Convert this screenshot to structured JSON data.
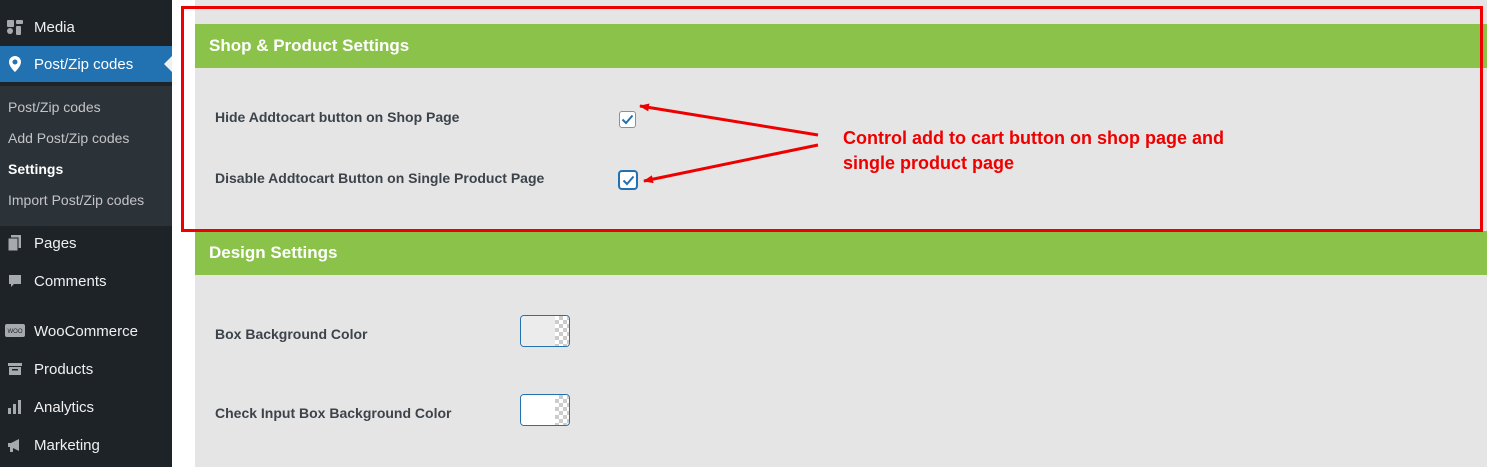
{
  "sidebar": {
    "items": [
      {
        "label": "Media",
        "icon": "media-icon"
      },
      {
        "label": "Post/Zip codes",
        "icon": "location-pin-icon",
        "active": true
      },
      {
        "label": "Pages",
        "icon": "pages-icon"
      },
      {
        "label": "Comments",
        "icon": "comments-icon"
      },
      {
        "label": "WooCommerce",
        "icon": "woocommerce-icon"
      },
      {
        "label": "Products",
        "icon": "products-icon"
      },
      {
        "label": "Analytics",
        "icon": "analytics-icon"
      },
      {
        "label": "Marketing",
        "icon": "marketing-icon"
      }
    ],
    "submenu": [
      {
        "label": "Post/Zip codes"
      },
      {
        "label": "Add Post/Zip codes"
      },
      {
        "label": "Settings",
        "current": true
      },
      {
        "label": "Import Post/Zip codes"
      }
    ],
    "colors": {
      "bg": "#1d2327",
      "active": "#2271b1",
      "submenu_bg": "#2c3338"
    }
  },
  "sections": {
    "shop": {
      "title": "Shop & Product Settings",
      "hide_shop_label": "Hide Addtocart button on Shop Page",
      "hide_shop_checked": true,
      "disable_single_label": "Disable Addtocart Button on Single Product Page",
      "disable_single_checked": true
    },
    "design": {
      "title": "Design Settings",
      "box_bg_label": "Box Background Color",
      "box_bg_color": "#ececec",
      "check_input_label": "Check Input Box Background Color",
      "check_input_color": "#ffffff"
    },
    "header_color": "#8bc34a"
  },
  "annotation": {
    "line1": "Control add to cart button on shop page and",
    "line2": "single product page",
    "color": "#ee0000"
  }
}
